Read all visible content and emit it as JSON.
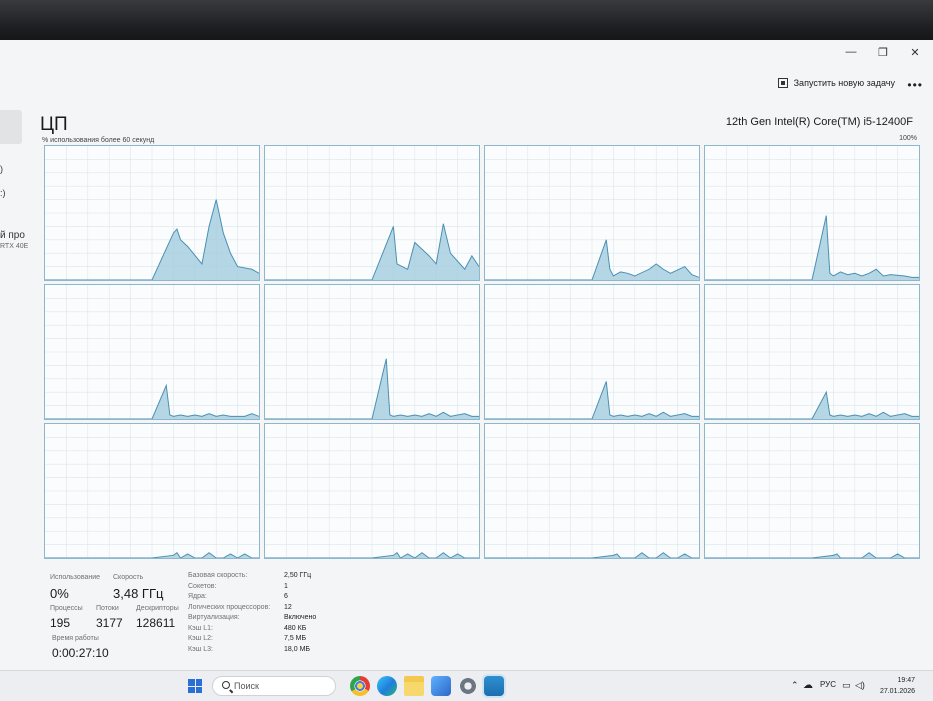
{
  "window": {
    "controls": [
      "—",
      "❐",
      "✕"
    ],
    "toolbar": {
      "new_task_label": "Запустить новую задачу",
      "more_label": "•••"
    }
  },
  "sidebar": {
    "fragments": [
      ")",
      ":)",
      "й про",
      "RTX 40E"
    ]
  },
  "header": {
    "title": "ЦП",
    "subtitle": "% использования более 60 секунд",
    "cpu_name": "12th Gen Intel(R) Core(TM) i5-12400F",
    "max_label": "100%"
  },
  "colors": {
    "graph_line": "#4a8fb2",
    "graph_fill": "#a8cfdf",
    "graph_border": "#8fb7cc",
    "grid": "#dbe6ec"
  },
  "chart_data": {
    "type": "area",
    "title": "",
    "ylim": [
      0,
      100
    ],
    "xlim": [
      0,
      60
    ],
    "grid": true,
    "series": [
      {
        "x": [
          0,
          30,
          36,
          37,
          38,
          40,
          44,
          46,
          48,
          50,
          52,
          54,
          58,
          60
        ],
        "values": [
          0,
          0,
          35,
          38,
          30,
          25,
          12,
          40,
          60,
          35,
          20,
          10,
          8,
          5
        ]
      },
      {
        "x": [
          0,
          30,
          36,
          37,
          40,
          42,
          46,
          48,
          50,
          52,
          56,
          58,
          60
        ],
        "values": [
          0,
          0,
          40,
          12,
          8,
          28,
          18,
          12,
          42,
          20,
          8,
          18,
          10
        ]
      },
      {
        "x": [
          0,
          30,
          34,
          35,
          36,
          38,
          40,
          42,
          46,
          48,
          50,
          52,
          56,
          58,
          60
        ],
        "values": [
          0,
          0,
          30,
          8,
          3,
          6,
          5,
          3,
          8,
          12,
          8,
          5,
          10,
          4,
          2
        ]
      },
      {
        "x": [
          0,
          30,
          34,
          35,
          36,
          38,
          40,
          42,
          44,
          46,
          48,
          50,
          52,
          56,
          58,
          60
        ],
        "values": [
          0,
          0,
          48,
          5,
          3,
          6,
          4,
          5,
          3,
          5,
          8,
          3,
          4,
          3,
          2,
          2
        ]
      },
      {
        "x": [
          0,
          30,
          34,
          35,
          36,
          38,
          40,
          42,
          44,
          46,
          48,
          50,
          52,
          56,
          58,
          60
        ],
        "values": [
          0,
          0,
          25,
          3,
          2,
          3,
          2,
          3,
          2,
          4,
          2,
          3,
          2,
          2,
          4,
          2
        ]
      },
      {
        "x": [
          0,
          30,
          34,
          35,
          36,
          38,
          40,
          42,
          44,
          46,
          48,
          50,
          52,
          56,
          58,
          60
        ],
        "values": [
          0,
          0,
          45,
          3,
          2,
          3,
          2,
          3,
          2,
          4,
          2,
          5,
          2,
          4,
          2,
          2
        ]
      },
      {
        "x": [
          0,
          30,
          34,
          35,
          36,
          38,
          40,
          42,
          44,
          46,
          48,
          50,
          52,
          56,
          58,
          60
        ],
        "values": [
          0,
          0,
          28,
          3,
          2,
          3,
          2,
          3,
          2,
          4,
          2,
          5,
          2,
          4,
          2,
          2
        ]
      },
      {
        "x": [
          0,
          30,
          34,
          35,
          36,
          38,
          40,
          42,
          44,
          46,
          48,
          50,
          52,
          56,
          58,
          60
        ],
        "values": [
          0,
          0,
          20,
          3,
          2,
          3,
          2,
          3,
          2,
          4,
          2,
          5,
          2,
          4,
          2,
          2
        ]
      },
      {
        "x": [
          0,
          30,
          36,
          37,
          38,
          40,
          42,
          44,
          46,
          48,
          50,
          52,
          54,
          56,
          58,
          60
        ],
        "values": [
          0,
          0,
          2,
          4,
          0,
          3,
          0,
          0,
          4,
          0,
          0,
          3,
          0,
          3,
          0,
          0
        ]
      },
      {
        "x": [
          0,
          30,
          36,
          37,
          38,
          40,
          42,
          44,
          46,
          48,
          50,
          52,
          54,
          56,
          58,
          60
        ],
        "values": [
          0,
          0,
          2,
          4,
          0,
          3,
          0,
          4,
          0,
          0,
          4,
          0,
          3,
          0,
          0,
          0
        ]
      },
      {
        "x": [
          0,
          30,
          36,
          37,
          38,
          40,
          42,
          44,
          46,
          48,
          50,
          52,
          54,
          56,
          58,
          60
        ],
        "values": [
          0,
          0,
          2,
          3,
          0,
          0,
          0,
          4,
          0,
          0,
          4,
          0,
          0,
          3,
          0,
          0
        ]
      },
      {
        "x": [
          0,
          30,
          36,
          37,
          38,
          40,
          42,
          44,
          46,
          48,
          50,
          52,
          54,
          56,
          58,
          60
        ],
        "values": [
          0,
          0,
          2,
          3,
          0,
          0,
          0,
          0,
          4,
          0,
          0,
          0,
          3,
          0,
          0,
          0
        ]
      }
    ]
  },
  "stats": {
    "usage_label": "Использование",
    "usage_value": "0%",
    "speed_label": "Скорость",
    "speed_value": "3,48 ГГц",
    "processes_label": "Процессы",
    "processes_value": "195",
    "threads_label": "Потоки",
    "threads_value": "3177",
    "handles_label": "Дескрипторы",
    "handles_value": "128611",
    "uptime_label": "Время работы",
    "uptime_value": "0:00:27:10"
  },
  "details": [
    {
      "key": "Базовая скорость:",
      "value": "2,50 ГГц"
    },
    {
      "key": "Сокетов:",
      "value": "1"
    },
    {
      "key": "Ядра:",
      "value": "6"
    },
    {
      "key": "Логических процессоров:",
      "value": "12"
    },
    {
      "key": "Виртуализация:",
      "value": "Включено"
    },
    {
      "key": "Кэш L1:",
      "value": "480 КБ"
    },
    {
      "key": "Кэш L2:",
      "value": "7,5 МБ"
    },
    {
      "key": "Кэш L3:",
      "value": "18,0 МБ"
    }
  ],
  "taskbar": {
    "search_placeholder": "Поиск",
    "apps": [
      "chrome-icon",
      "edge-icon",
      "file-explorer-icon",
      "photos-icon",
      "settings-icon",
      "task-manager-icon"
    ],
    "language": "РУС",
    "time": "19:47",
    "date": "27.01.2026"
  }
}
